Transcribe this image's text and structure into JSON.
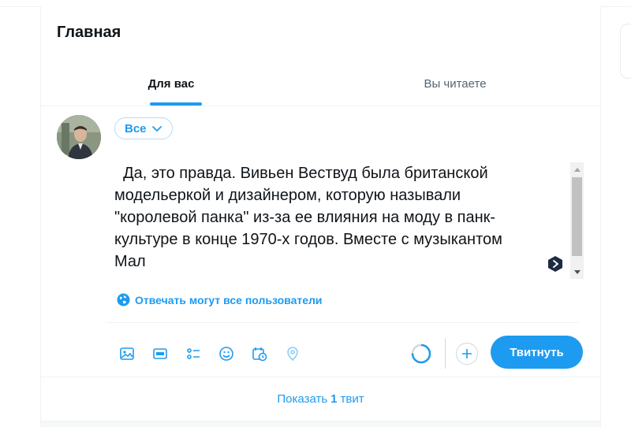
{
  "header": {
    "title": "Главная"
  },
  "tabs": [
    {
      "label": "Для вас",
      "active": true
    },
    {
      "label": "Вы читаете",
      "active": false
    }
  ],
  "composer": {
    "audience_label": "Все",
    "text": "  Да, это правда. Вивьен Вествуд была британской\nмодельеркой и дизайнером, которую называли\n\"королевой панка\" из-за ее влияния на моду в панк-\nкультуре в конце 1970-х годов. Вместе с музыкантом\nМал",
    "reply_setting": "Отвечать могут все пользователи",
    "tools": [
      {
        "icon": "image-icon"
      },
      {
        "icon": "gif-icon"
      },
      {
        "icon": "poll-icon"
      },
      {
        "icon": "emoji-icon"
      },
      {
        "icon": "schedule-icon"
      },
      {
        "icon": "location-icon"
      }
    ],
    "tweet_button": "Твитнуть"
  },
  "show_tweets": {
    "prefix": "Показать",
    "count": "1",
    "suffix": "твит"
  },
  "colors": {
    "accent": "#1d9bf0",
    "text": "#0f1419",
    "muted": "#536471",
    "border": "#eff3f4"
  }
}
